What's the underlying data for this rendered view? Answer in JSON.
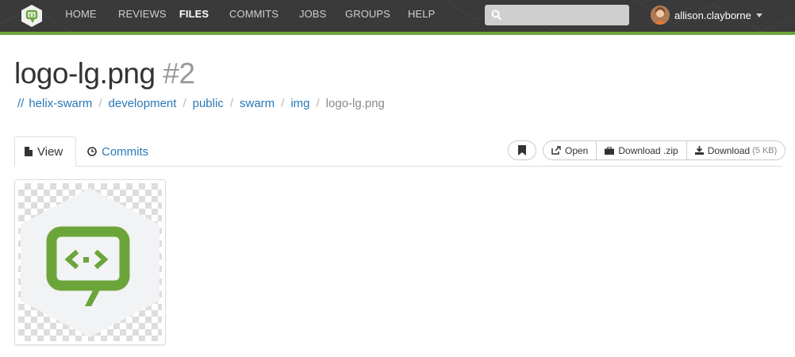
{
  "nav": {
    "items": [
      "HOME",
      "REVIEWS",
      "FILES",
      "COMMITS",
      "JOBS",
      "GROUPS",
      "HELP"
    ],
    "active": "FILES",
    "accent": "#6ba53a",
    "bg": "#3a3a3a"
  },
  "search": {
    "placeholder": ""
  },
  "user": {
    "name": "allison.clayborne"
  },
  "file": {
    "name": "logo-lg.png",
    "revision": "#2"
  },
  "breadcrumb": {
    "root": "//",
    "items": [
      "helix-swarm",
      "development",
      "public",
      "swarm",
      "img"
    ],
    "current": "logo-lg.png"
  },
  "tabs": {
    "view": "View",
    "commits": "Commits"
  },
  "actions": {
    "open": "Open",
    "download_zip": "Download .zip",
    "download": "Download",
    "download_size": "(5 KB)"
  },
  "icons": [
    "swarm-logo-icon",
    "search-icon",
    "bookmark-icon",
    "open-icon",
    "briefcase-icon",
    "download-icon",
    "file-icon",
    "clock-icon"
  ]
}
